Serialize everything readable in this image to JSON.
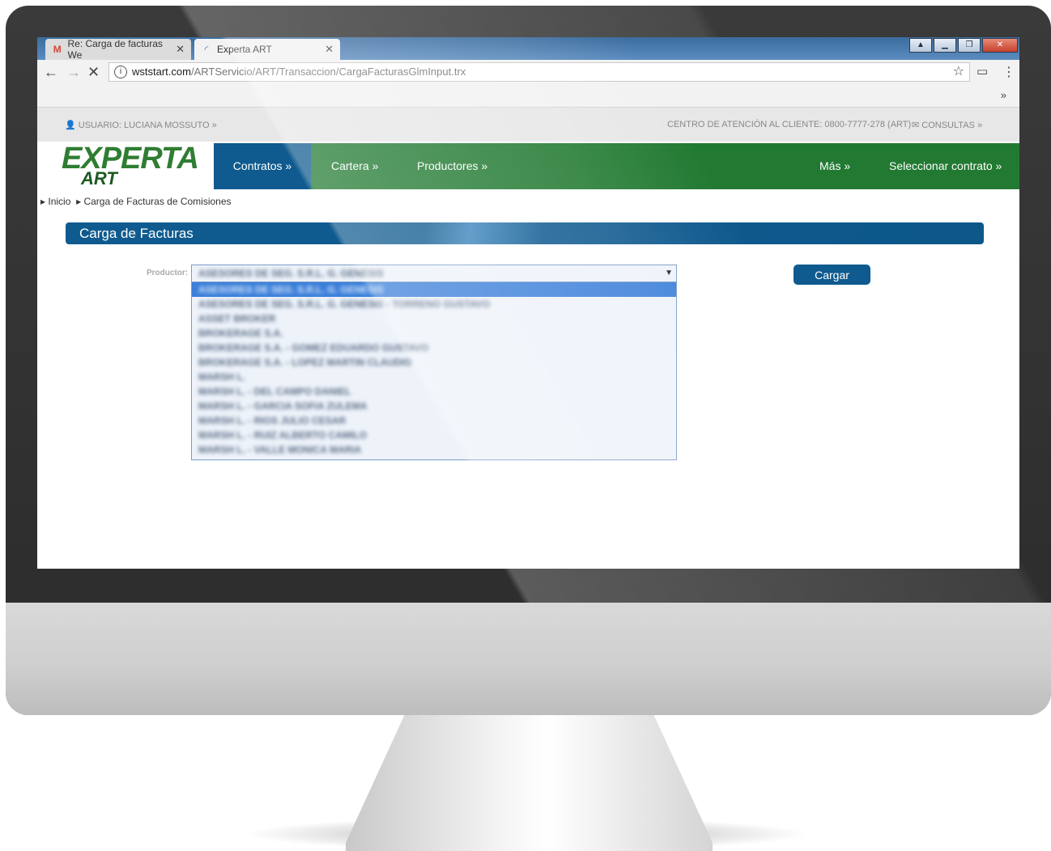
{
  "browser": {
    "tabs": [
      {
        "label": "Re: Carga de facturas We",
        "icon": "gmail-icon"
      },
      {
        "label": "Experta ART",
        "icon": "loading-icon"
      }
    ],
    "url_host": "wststart.com",
    "url_path": "/ARTServicio/ART/Transaccion/CargaFacturasGlmInput.trx",
    "bookmarks_more": "»"
  },
  "topstrip": {
    "user": "USUARIO: LUCIANA MOSSUTO",
    "help": "CENTRO DE ATENCIÓN AL CLIENTE: 0800-7777-278 (ART)",
    "consultas": "CONSULTAS"
  },
  "logo": {
    "line1": "EXPERTA",
    "line2": "ART"
  },
  "nav": {
    "contratos": "Contratos",
    "cartera": "Cartera",
    "productores": "Productores",
    "mas": "Más",
    "seleccionar": "Seleccionar contrato"
  },
  "breadcrumb": {
    "home": "Inicio",
    "current": "Carga de Facturas de Comisiones"
  },
  "page": {
    "title": "Carga de Facturas"
  },
  "form": {
    "label": "Productor:",
    "selected": "ASESORES DE SEG. S.R.L. G. GENESIS",
    "options": [
      "ASESORES DE SEG. S.R.L. G. GENESIS",
      "ASESORES DE SEG. S.R.L. G. GENESIS - TORRENO GUSTAVO",
      "ASSET BROKER",
      "BROKERAGE S.A.",
      "BROKERAGE S.A. - GOMEZ EDUARDO GUSTAVO",
      "BROKERAGE S.A. - LOPEZ MARTIN CLAUDIO",
      "MARSH L.",
      "MARSH L. - DEL CAMPO DANIEL",
      "MARSH L. - GARCIA SOFIA ZULEMA",
      "MARSH L. - RIOS JULIO CESAR",
      "MARSH L. - RUIZ ALBERTO CAMILO",
      "MARSH L. - VALLE MONICA MARIA"
    ],
    "submit": "Cargar"
  }
}
